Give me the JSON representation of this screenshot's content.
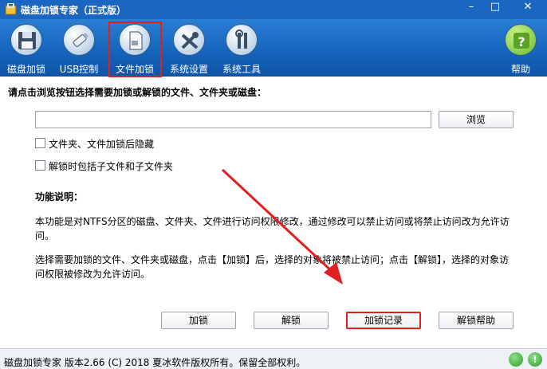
{
  "window": {
    "title": "磁盘加锁专家（正式版）",
    "controls": {
      "minimize": "–",
      "maximize": "□",
      "close": "✕"
    }
  },
  "toolbar": {
    "items": [
      {
        "label": "磁盘加锁",
        "icon": "floppy-disk-icon"
      },
      {
        "label": "USB控制",
        "icon": "usb-drive-icon"
      },
      {
        "label": "文件加锁",
        "icon": "document-icon",
        "active": true
      },
      {
        "label": "系统设置",
        "icon": "tools-icon"
      },
      {
        "label": "系统工具",
        "icon": "wrench-screwdriver-icon"
      },
      {
        "label": "帮助",
        "icon": "help-icon"
      }
    ]
  },
  "main": {
    "prompt": "请点击浏览按钮选择需要加锁或解锁的文件、文件夹或磁盘：",
    "path_value": "",
    "browse_label": "浏览",
    "checkboxes": [
      {
        "label": "文件夹、文件加锁后隐藏",
        "checked": false
      },
      {
        "label": "解锁时包括子文件和子文件夹",
        "checked": false
      }
    ],
    "section_title": "功能说明：",
    "para1": "本功能是对NTFS分区的磁盘、文件夹、文件进行访问权限修改，通过修改可以禁止访问或将禁止访问改为允许访问。",
    "para2": "选择需要加锁的文件、文件夹或磁盘，点击【加锁】后，选择的对象将被禁止访问；点击【解锁】，选择的对象访问权限被修改为允许访问。",
    "buttons": {
      "lock": "加锁",
      "unlock": "解锁",
      "log": "加锁记录",
      "help": "解锁帮助"
    }
  },
  "status": {
    "text": "磁盘加锁专家 版本2.66 (C)  2018 夏冰软件版权所有。保留全部权利。",
    "info_glyph": "!"
  },
  "colors": {
    "titlebar": "#1a66c0",
    "toolbar": "#1563bb",
    "highlight": "#e02020"
  }
}
